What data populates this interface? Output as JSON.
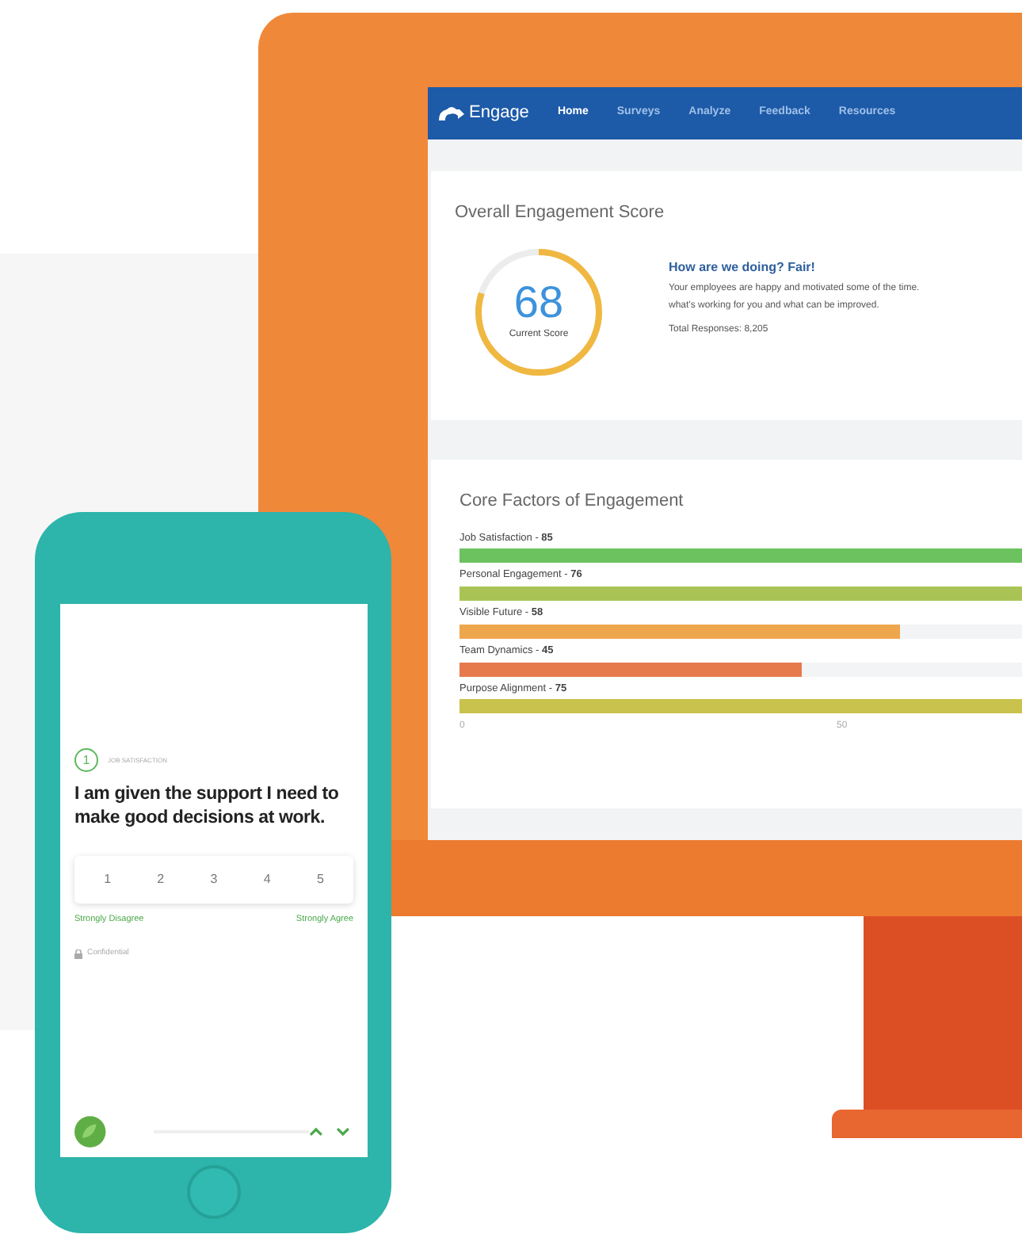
{
  "dashboard": {
    "brand": "Engage",
    "nav": [
      {
        "label": "Home",
        "selected": true
      },
      {
        "label": "Surveys",
        "selected": false
      },
      {
        "label": "Analyze",
        "selected": false
      },
      {
        "label": "Feedback",
        "selected": false
      },
      {
        "label": "Resources",
        "selected": false
      }
    ],
    "score_card": {
      "title": "Overall Engagement Score",
      "score": "68",
      "score_label": "Current Score",
      "level": 0.8,
      "headline": "How are we doing? Fair!",
      "description_lines": [
        "Your employees are happy and motivated some of the time.",
        "what's working for you and what can be improved."
      ],
      "responses": "Total Responses: 8,205"
    },
    "factors_card": {
      "title": "Core Factors of Engagement",
      "factors": [
        {
          "name": "Job Satisfaction -",
          "value": "85",
          "level": 0.85,
          "color": "#6cc25f"
        },
        {
          "name": "Personal Engagement -",
          "value": "76",
          "level": 0.76,
          "color": "#a9c455"
        },
        {
          "name": "Visible Future -",
          "value": "58",
          "level": 0.58,
          "color": "#eea64c"
        },
        {
          "name": "Team Dynamics -",
          "value": "45",
          "level": 0.45,
          "color": "#e67a4c"
        },
        {
          "name": "Purpose Alignment -",
          "value": "75",
          "level": 0.75,
          "color": "#c9c24c"
        }
      ],
      "axis_ticks": [
        "0",
        "50"
      ]
    }
  },
  "phone_survey": {
    "question_number": "1",
    "category": "JOB SATISFACTION",
    "question": "I am given the support I need to make good decisions at work.",
    "options": [
      "1",
      "2",
      "3",
      "4",
      "5"
    ],
    "low_label": "Strongly Disagree",
    "high_label": "Strongly Agree",
    "privacy": "Confidential"
  }
}
